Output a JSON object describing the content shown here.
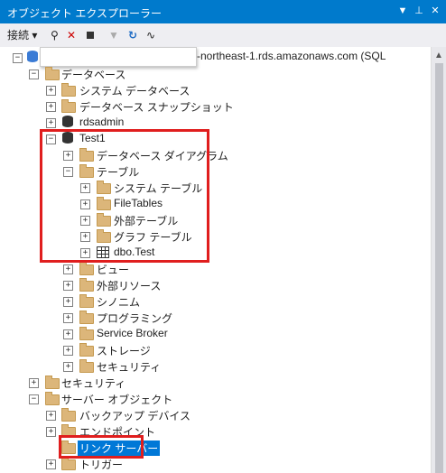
{
  "window": {
    "title": "オブジェクト エクスプローラー"
  },
  "toolbar": {
    "connect_label": "接続"
  },
  "server": {
    "text": "-northeast-1.rds.amazonaws.com (SQL"
  },
  "tree": {
    "databases": "データベース",
    "system_databases": "システム データベース",
    "db_snapshots": "データベース スナップショット",
    "rdsadmin": "rdsadmin",
    "test1": "Test1",
    "db_diagrams": "データベース ダイアグラム",
    "tables": "テーブル",
    "system_tables": "システム テーブル",
    "filetables": "FileTables",
    "external_tables": "外部テーブル",
    "graph_tables": "グラフ テーブル",
    "dbo_test": "dbo.Test",
    "views": "ビュー",
    "external_resources": "外部リソース",
    "synonyms": "シノニム",
    "programmability": "プログラミング",
    "service_broker": "Service Broker",
    "storage": "ストレージ",
    "security_db": "セキュリティ",
    "security": "セキュリティ",
    "server_objects": "サーバー オブジェクト",
    "backup_devices": "バックアップ デバイス",
    "endpoints": "エンドポイント",
    "linked_servers": "リンク サーバー",
    "triggers": "トリガー"
  },
  "colors": {
    "accent": "#007acc",
    "highlight": "#e01e1e",
    "selected": "#0078d7"
  }
}
